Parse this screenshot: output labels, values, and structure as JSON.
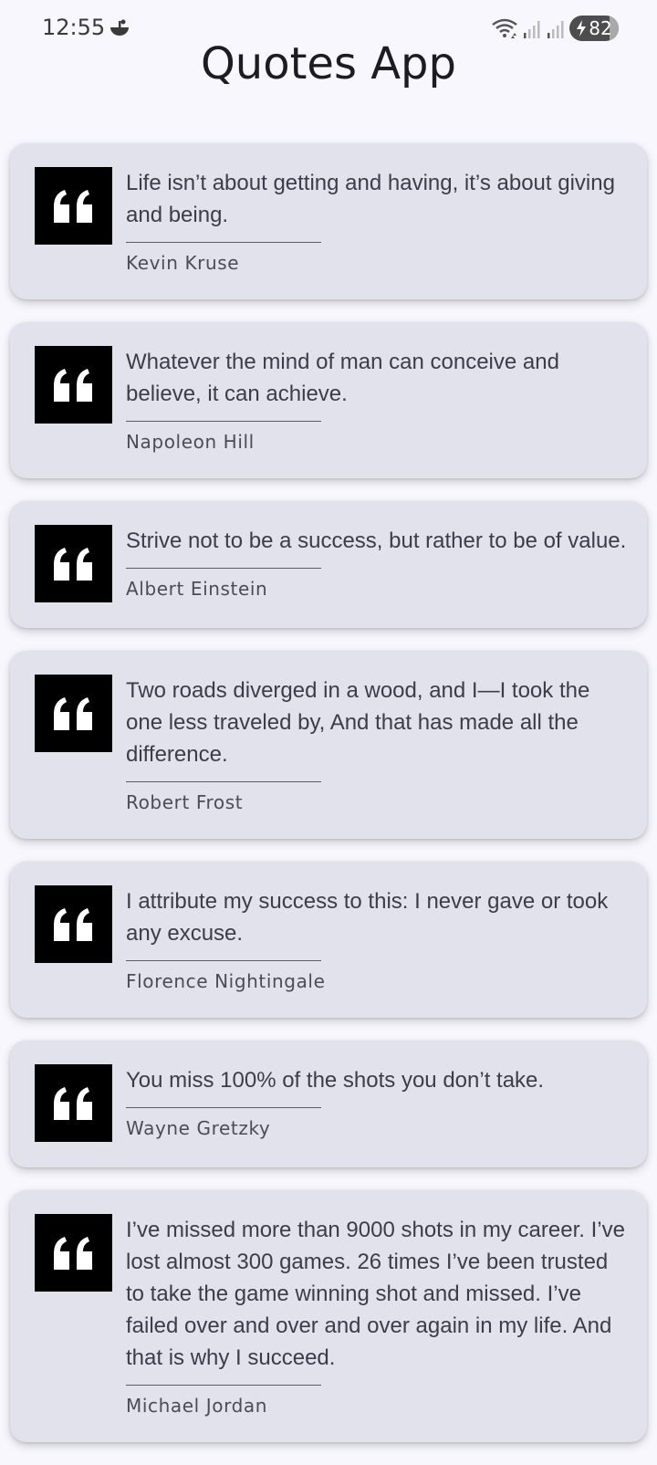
{
  "status_bar": {
    "time": "12:55",
    "battery_level": "82"
  },
  "app": {
    "title": "Quotes App"
  },
  "quotes": [
    {
      "text": "Life isn’t about getting and having, it’s about giving and being.",
      "author": "Kevin Kruse"
    },
    {
      "text": "Whatever the mind of man can conceive and believe, it can achieve.",
      "author": "Napoleon Hill"
    },
    {
      "text": "Strive not to be a success, but rather to be of value.",
      "author": "Albert Einstein"
    },
    {
      "text": "Two roads diverged in a wood, and I—I took the one less traveled by, And that has made all the difference.",
      "author": "Robert Frost"
    },
    {
      "text": "I attribute my success to this: I never gave or took any excuse.",
      "author": "Florence Nightingale"
    },
    {
      "text": "You miss 100% of the shots you don’t take.",
      "author": "Wayne Gretzky"
    },
    {
      "text": "I’ve missed more than 9000 shots in my career. I’ve lost almost 300 games. 26 times I’ve been trusted to take the game winning shot and missed. I’ve failed over and over and over again in my life. And that is why I succeed.",
      "author": "Michael Jordan"
    }
  ],
  "icons": {
    "quote": "quote-icon",
    "wifi": "wifi-icon",
    "signal": "signal-icon",
    "charging": "charging-icon",
    "status_app": "app-notification-icon"
  },
  "colors": {
    "background": "#f7f7fd",
    "card": "#e2e2ec",
    "icon_box": "#000000",
    "text": "#3b3d4a"
  }
}
